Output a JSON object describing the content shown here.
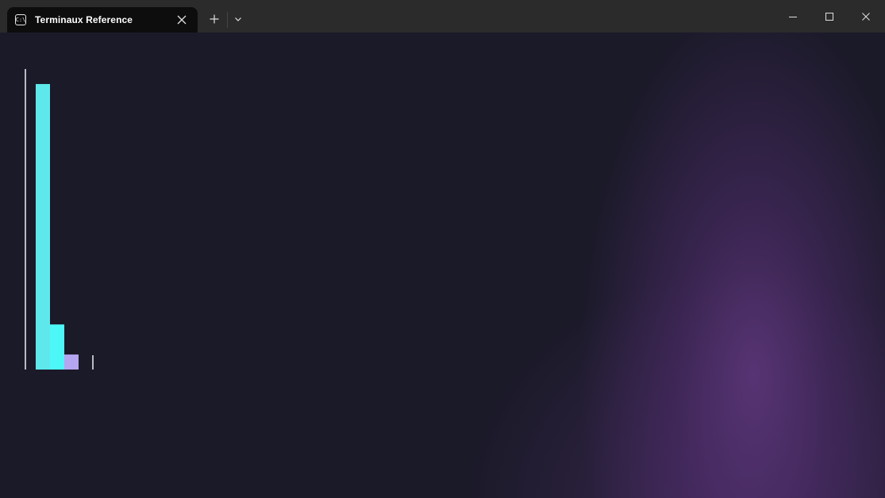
{
  "window": {
    "tab_title": "Terminaux Reference",
    "tab_icon": "terminal-icon",
    "tab_icon_text": "C:\\"
  },
  "colors": {
    "titlebar": "#2b2b2b",
    "active_tab": "#0d0d0d",
    "terminal_bg": "#1b1a29",
    "accent_glow": "#5f377d",
    "bar_cyan_light": "#5ee8ec",
    "bar_cyan": "#4df7f7",
    "bar_lavender": "#b4a6f0",
    "axis": "#f0f0f0"
  },
  "chart_data": {
    "type": "bar",
    "categories": [
      "",
      "",
      ""
    ],
    "values": [
      19,
      3,
      1
    ],
    "colors": [
      "#5ee8ec",
      "#4df7f7",
      "#b4a6f0"
    ],
    "ylim": [
      0,
      20
    ],
    "title": "",
    "xlabel": "",
    "ylabel": "",
    "grid": false,
    "legend": "none"
  }
}
